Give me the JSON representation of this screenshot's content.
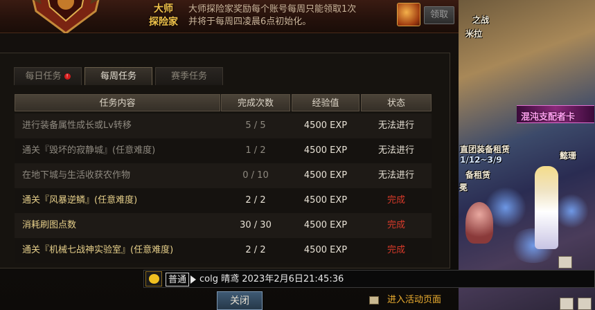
{
  "banner": {
    "title_line1": "大师",
    "title_line2": "探险家",
    "desc_line1": "大师探险家奖励每个账号每周只能领取1次",
    "desc_line2": "并将于每周四凌晨6点初始化。",
    "claim_label": "领取"
  },
  "tabs": [
    {
      "label": "每日任务",
      "active": false,
      "badge": "!"
    },
    {
      "label": "每周任务",
      "active": true
    },
    {
      "label": "赛季任务",
      "active": false
    }
  ],
  "table": {
    "headers": [
      "任务内容",
      "完成次数",
      "经验值",
      "状态"
    ],
    "rows": [
      {
        "task": "进行装备属性成长或Lv转移",
        "count": "5 / 5",
        "exp": "4500 EXP",
        "status": "无法进行"
      },
      {
        "task": "通关『毁坏的寂静城』(任意难度)",
        "count": "1 / 2",
        "exp": "4500 EXP",
        "status": "无法进行"
      },
      {
        "task": "在地下城与生活收获农作物",
        "count": "0 / 10",
        "exp": "4500 EXP",
        "status": "无法进行"
      },
      {
        "task": "通关『风暴逆鳞』(任意难度)",
        "count": "2 / 2",
        "exp": "4500 EXP",
        "status": "完成"
      },
      {
        "task": "消耗刷图点数",
        "count": "30 / 30",
        "exp": "4500 EXP",
        "status": "完成"
      },
      {
        "task": "通关『机械七战神实验室』(任意难度)",
        "count": "2 / 2",
        "exp": "4500 EXP",
        "status": "完成"
      }
    ]
  },
  "chat": {
    "channel": "普通",
    "message": "colg  晴鸢  2023年2月6日21:45:36"
  },
  "footer": {
    "close_label": "关闭",
    "activity_label": "进入活动页面"
  },
  "scene": {
    "labels": [
      "之战",
      "米拉",
      "混沌支配者卡",
      "直团装备租赁",
      "1/12~3/9",
      "备租赁",
      "懿珊",
      "冕"
    ]
  },
  "colors": {
    "complete": "#d83a2a",
    "gold": "#e6cf8a",
    "accent": "#f0b030"
  }
}
